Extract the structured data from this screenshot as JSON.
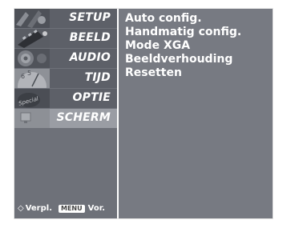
{
  "menu": {
    "items": [
      {
        "label": "SETUP",
        "icon": "satellite-dish-icon",
        "active": false
      },
      {
        "label": "BEELD",
        "icon": "film-strip-icon",
        "active": false
      },
      {
        "label": "AUDIO",
        "icon": "speaker-icon",
        "active": false
      },
      {
        "label": "TIJD",
        "icon": "clock-icon",
        "active": false
      },
      {
        "label": "OPTIE",
        "icon": "special-tag-icon",
        "active": false
      },
      {
        "label": "SCHERM",
        "icon": "screen-icon",
        "active": true
      }
    ]
  },
  "content": {
    "options": [
      "Auto config.",
      "Handmatig config.",
      "Mode XGA",
      "Beeldverhouding",
      "Resetten"
    ]
  },
  "footer": {
    "move_icon": "◇",
    "move_label": "Verpl.",
    "menu_key": "MENU",
    "menu_label": "Vor."
  },
  "colors": {
    "panel_bg": "#777a82",
    "item_bg": "#5d6068",
    "item_active_bg": "#9a9da4",
    "text": "#ffffff"
  }
}
